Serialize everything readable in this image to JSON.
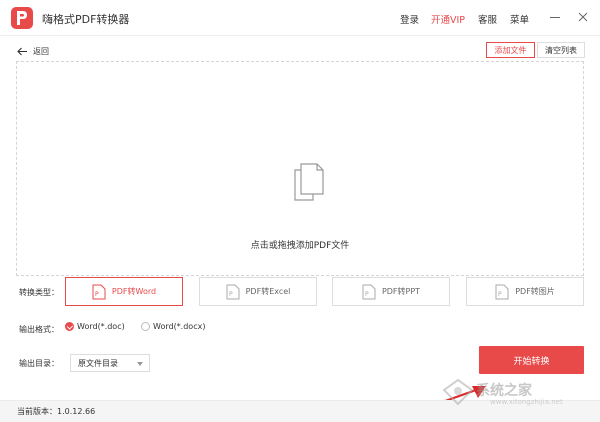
{
  "app": {
    "title": "嗨格式PDF转换器"
  },
  "menu": {
    "login": "登录",
    "vip": "开通VIP",
    "service": "客服",
    "menu": "菜单"
  },
  "toolbar": {
    "back_label": "返回",
    "add_file": "添加文件",
    "clear_list": "清空列表"
  },
  "dropzone": {
    "text": "点击或拖拽添加PDF文件"
  },
  "convert": {
    "label": "转换类型：",
    "options": [
      {
        "label": "PDF转Word",
        "active": true
      },
      {
        "label": "PDF转Excel",
        "active": false
      },
      {
        "label": "PDF转PPT",
        "active": false
      },
      {
        "label": "PDF转图片",
        "active": false
      }
    ]
  },
  "format": {
    "label": "输出格式：",
    "options": [
      {
        "label": "Word(*.doc)",
        "selected": true
      },
      {
        "label": "Word(*.docx)",
        "selected": false
      }
    ]
  },
  "output": {
    "label": "输出目录：",
    "value": "原文件目录"
  },
  "start_button": "开始转换",
  "status": {
    "version": "当前版本：1.0.12.66"
  },
  "watermark": {
    "text": "系统之家",
    "url": "www.xitongzhijia.net"
  },
  "colors": {
    "accent": "#e84a4a",
    "border": "#dddddd",
    "status_bg": "#f5f5f5"
  },
  "icons": [
    "app-logo-icon",
    "back-arrow-icon",
    "document-icon",
    "pdf-file-icon",
    "minimize-icon",
    "close-icon",
    "chevron-down-icon",
    "pointer-arrow"
  ]
}
